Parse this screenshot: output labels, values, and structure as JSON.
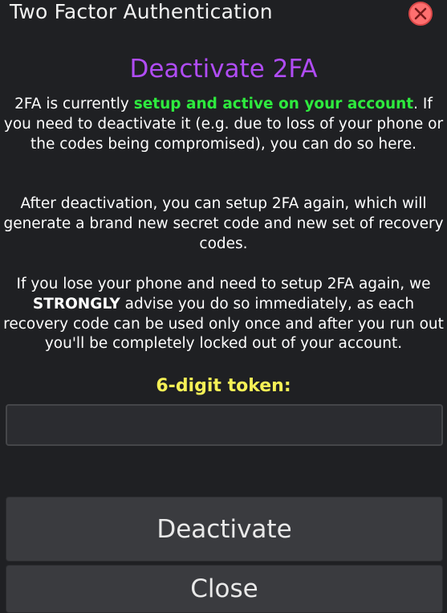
{
  "window": {
    "title": "Two Factor Authentication",
    "close_icon": "close-x-icon"
  },
  "deactivate": {
    "heading": "Deactivate 2FA",
    "para1": {
      "before": "2FA is currently ",
      "highlight": "setup and active on your account",
      "after": ". If you need to deactivate it (e.g. due to loss of your phone or the codes being compromised), you can do so here."
    },
    "para2": "After deactivation, you can setup 2FA again, which will generate a brand new secret code and new set of recovery codes.",
    "para3": {
      "before": "If you lose your phone and need to setup 2FA again, we ",
      "emphasis": "STRONGLY",
      "after": " advise you do so immediately, as each recovery code can be used only once and after you run out you'll be completely locked out of your account."
    },
    "token_label": "6-digit token:",
    "token_value": "",
    "token_placeholder": ""
  },
  "buttons": {
    "deactivate_label": "Deactivate",
    "close_label": "Close"
  },
  "colors": {
    "background": "#1f2023",
    "heading": "#b04cf5",
    "highlight_green": "#2eea3e",
    "token_label_yellow": "#f5f056",
    "close_red": "#ff6f6f",
    "button_bg": "#3a3b3f"
  }
}
